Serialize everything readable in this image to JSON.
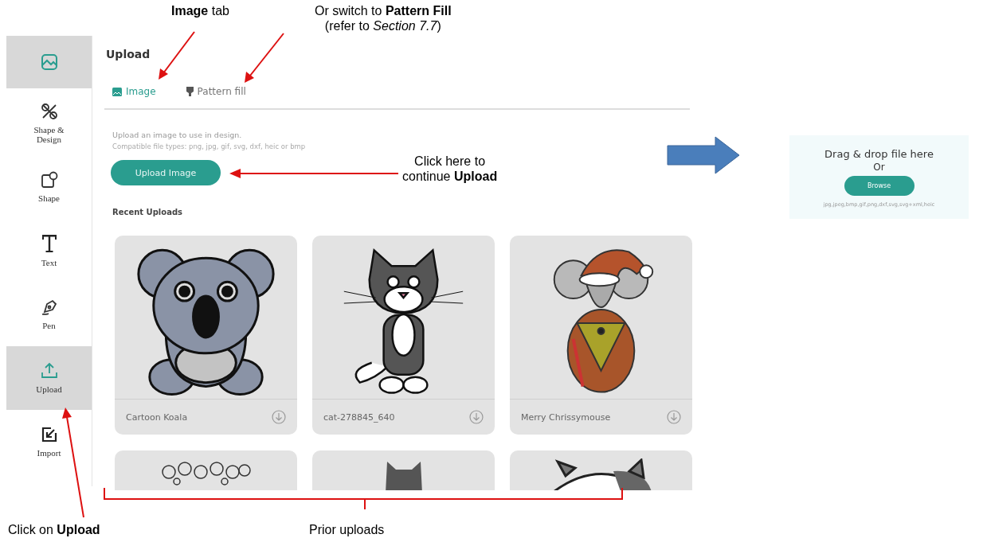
{
  "sidebar": {
    "items": [
      {
        "selected": true
      },
      {
        "label": "Shape & Design",
        "selected": false
      },
      {
        "label": "Shape",
        "selected": false
      },
      {
        "label": "Text",
        "selected": false
      },
      {
        "label": "Pen",
        "selected": false
      },
      {
        "label": "Upload",
        "selected": true
      },
      {
        "label": "Import",
        "selected": false
      }
    ]
  },
  "panel": {
    "title": "Upload",
    "tabs": [
      {
        "label": "Image",
        "selected": true
      },
      {
        "label": "Pattern fill",
        "selected": false
      }
    ],
    "description": "Upload an image to use in design.",
    "file_types": "Compatible file types: png, jpg, gif, svg, dxf, heic or bmp",
    "upload_button": "Upload Image",
    "recent_title": "Recent Uploads",
    "uploads": [
      {
        "kind": "koala",
        "name": "Cartoon Koala"
      },
      {
        "kind": "cat",
        "name": "cat-278845_640"
      },
      {
        "kind": "mouse",
        "name": "Merry Chrissymouse"
      },
      {
        "kind": "flowers"
      },
      {
        "kind": "cathead"
      },
      {
        "kind": "cow"
      }
    ]
  },
  "drop_zone": {
    "title": "Drag & drop file here",
    "or": "Or",
    "button": "Browse",
    "formats": "jpg,jpeg,bmp,gif,png,dxf,svg,svg+xml,heic"
  },
  "annotations": [
    {
      "lines": [
        "**Image** tab"
      ]
    },
    {
      "lines": [
        "Or switch to **Pattern Fill**",
        "(refer to *Section 7.7*)"
      ]
    },
    {
      "lines": [
        "Click  here to",
        "continue **Upload**"
      ]
    },
    {
      "lines": [
        "Click on **Upload**"
      ]
    },
    {
      "lines": [
        "Prior uploads"
      ]
    }
  ]
}
